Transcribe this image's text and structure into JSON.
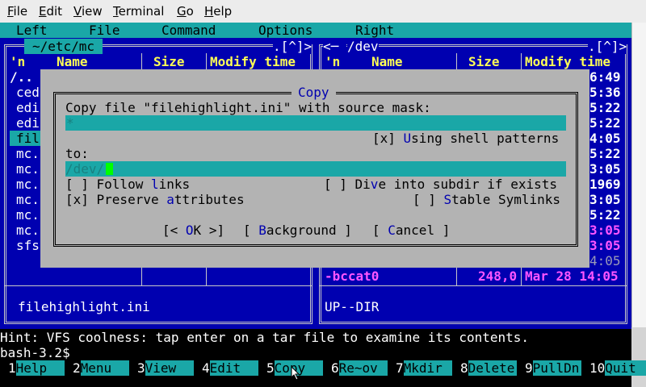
{
  "window_menu": [
    {
      "label": "File",
      "u": "F",
      "rest": "ile"
    },
    {
      "label": "Edit",
      "u": "E",
      "rest": "dit"
    },
    {
      "label": "View",
      "u": "V",
      "rest": "iew"
    },
    {
      "label": "Terminal",
      "u": "T",
      "rest": "erminal"
    },
    {
      "label": "Go",
      "u": "G",
      "rest": "o"
    },
    {
      "label": "Help",
      "u": "H",
      "rest": "elp"
    }
  ],
  "mc_menu": [
    "Left",
    "File",
    "Command",
    "Options",
    "Right"
  ],
  "left_panel": {
    "path": "~/etc/mc",
    "corner": ".[^]>",
    "columns": {
      "n": "'n",
      "name": "Name",
      "size": "Size",
      "mtime": "Modify time"
    },
    "rows": [
      "/..",
      "ced",
      "edi",
      "edi",
      "fil",
      "mc.",
      "mc.",
      "mc.",
      "mc.",
      "mc.",
      "mc.",
      "sfs"
    ],
    "selected_index": 4,
    "status": "filehighlight.ini"
  },
  "right_panel": {
    "path": "/dev",
    "corner": ".[^]>",
    "columns": {
      "n": "'n",
      "name": "Name",
      "size": "Size",
      "mtime": "Modify time"
    },
    "rows_time": [
      "6:49",
      "5:36",
      "5:22",
      "5:22",
      "4:05",
      "5:22",
      "3:05",
      "1969",
      "3:05",
      "5:22",
      "3:05",
      "3:05",
      "4:05"
    ],
    "last_row": {
      "name": "-bccat0",
      "size": "248,0",
      "mtime": "Mar 28 14:05"
    },
    "status": "UP--DIR"
  },
  "dialog": {
    "title": "Copy",
    "source_label": "Copy file \"filehighlight.ini\" with source mask:",
    "source_value": "*",
    "shell_patterns": {
      "mark": "[x] ",
      "u": "U",
      "rest": "sing shell patterns"
    },
    "to_label": "to:",
    "to_value": "/dev/",
    "follow_links": {
      "mark": "[ ] ",
      "pre": "Follow ",
      "u": "l",
      "rest": "inks"
    },
    "dive": {
      "mark": "[ ] ",
      "pre": "Di",
      "u": "v",
      "rest": "e into subdir if exists"
    },
    "preserve": {
      "mark": "[x] ",
      "pre": "Preserve ",
      "u": "a",
      "rest": "ttributes"
    },
    "stable": {
      "mark": "[ ] ",
      "pre": "",
      "u": "S",
      "rest": "table Symlinks"
    },
    "ok_button": {
      "pre": "[< ",
      "u": "O",
      "rest": "K >]"
    },
    "background_button": {
      "pre": "[ ",
      "u": "B",
      "rest": "ackground ]"
    },
    "cancel_button": {
      "pre": "[ ",
      "u": "C",
      "rest": "ancel ]"
    }
  },
  "hint": "Hint: VFS coolness: tap enter on a tar file to examine its contents.",
  "prompt": "bash-3.2$ ",
  "function_keys": [
    {
      "n": "1",
      "label": "Help"
    },
    {
      "n": "2",
      "label": "Menu"
    },
    {
      "n": "3",
      "label": "View"
    },
    {
      "n": "4",
      "label": "Edit"
    },
    {
      "n": "5",
      "label": "Copy"
    },
    {
      "n": "6",
      "label": "Re~ov"
    },
    {
      "n": "7",
      "label": "Mkdir"
    },
    {
      "n": "8",
      "label": "Delete"
    },
    {
      "n": "9",
      "label": "PullDn"
    },
    {
      "n": "10",
      "label": "Quit"
    }
  ],
  "colors": {
    "panel": "#0000b0",
    "cyan": "#1aa7a7",
    "dialog": "#b3b3b3",
    "highlight": "#ffff55",
    "magenta": "#ff55ff"
  }
}
